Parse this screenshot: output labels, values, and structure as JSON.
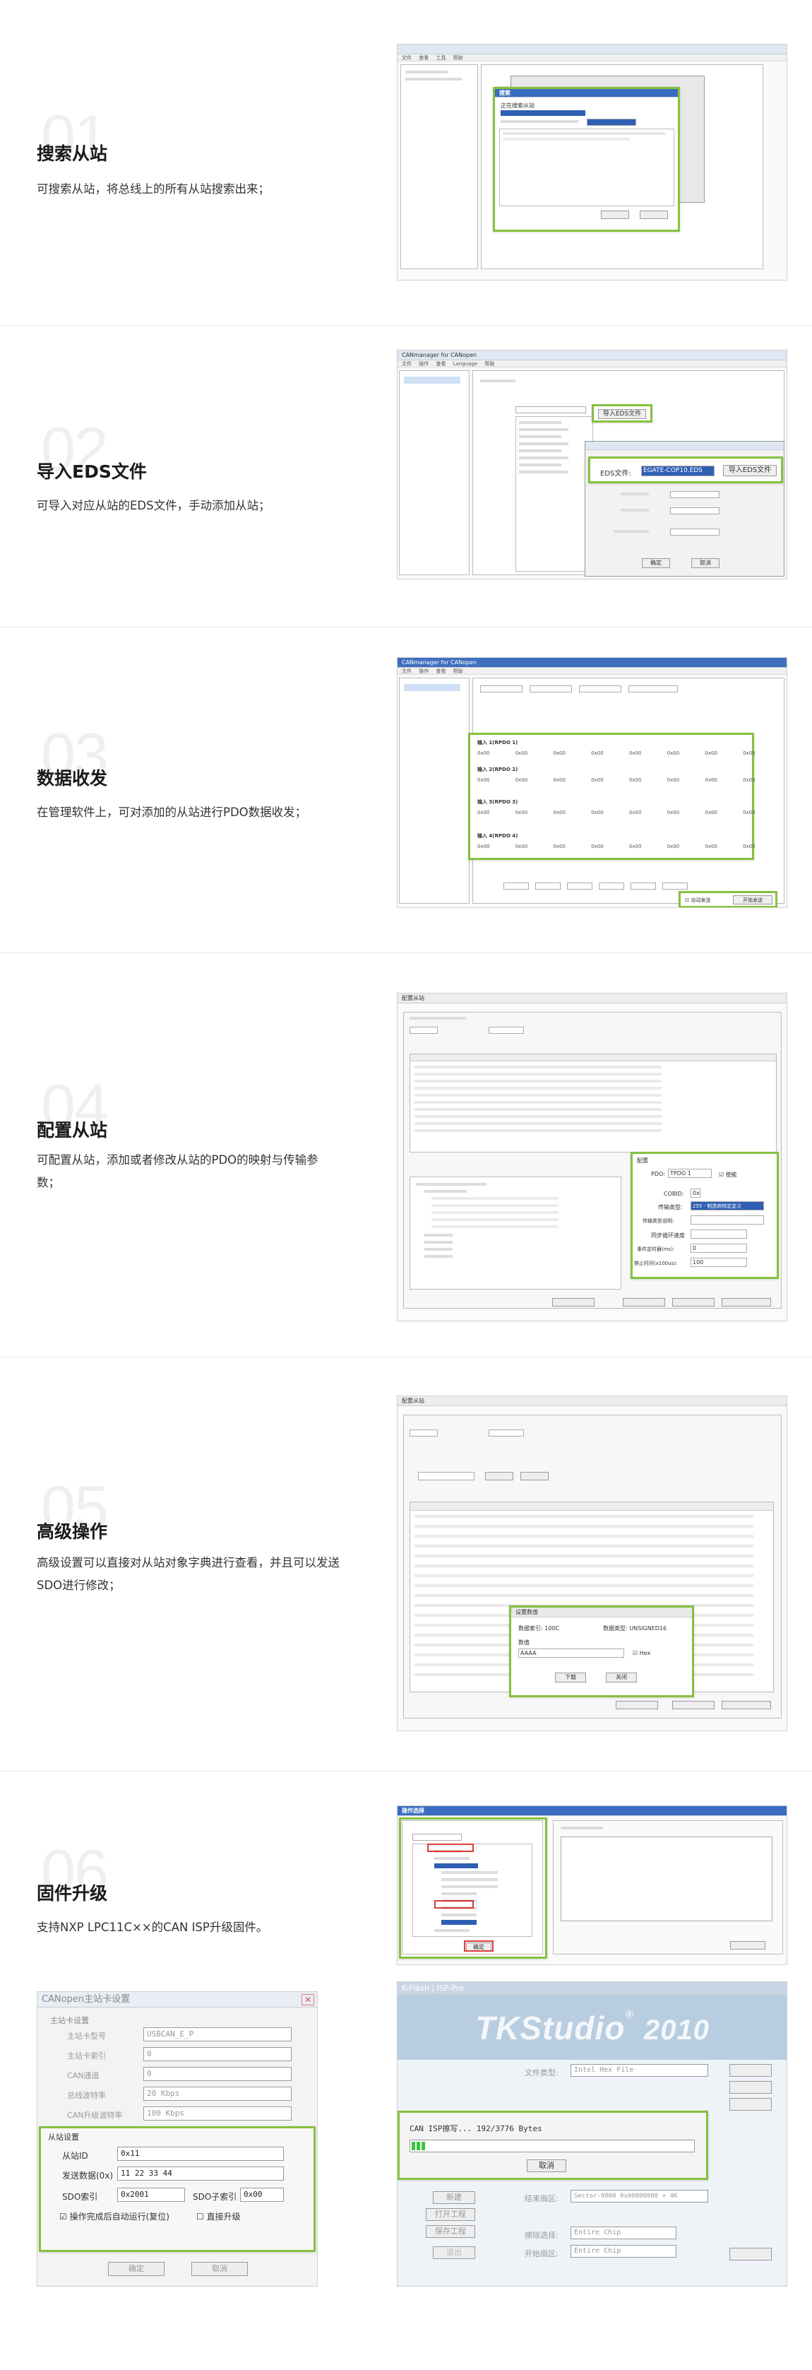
{
  "features": [
    {
      "num": "01",
      "title": "搜索从站",
      "desc": "可搜索从站，将总线上的所有从站搜索出来；"
    },
    {
      "num": "02",
      "title": "导入EDS文件",
      "desc": "可导入对应从站的EDS文件，手动添加从站；"
    },
    {
      "num": "03",
      "title": "数据收发",
      "desc": "在管理软件上，可对添加的从站进行PDO数据收发；"
    },
    {
      "num": "04",
      "title": "配置从站",
      "desc": "可配置从站，添加或者修改从站的PDO的映射与传输参数；"
    },
    {
      "num": "05",
      "title": "高级操作",
      "desc": "高级设置可以直接对从站对象字典进行查看，并且可以发送SDO进行修改；"
    },
    {
      "num": "06",
      "title": "固件升级",
      "desc": "支持NXP LPC11C××的CAN ISP升级固件。"
    }
  ],
  "shot2": {
    "app_title": "CANmanager for CANopen",
    "import_button": "导入EDS文件",
    "dialog": {
      "eds_label": "EDS文件:",
      "eds_value": "EGATE-COP10.EDS",
      "import_button": "导入EDS文件",
      "ok": "确定",
      "cancel": "取消"
    }
  },
  "shot3": {
    "app_title": "CANmanager for CANopen",
    "rows": [
      {
        "label": "输入 1(RPDO 1)",
        "cells": "0x00 0x00 0x00 0x00 0x00 0x00 0x00 0x00"
      },
      {
        "label": "输入 2(RPDO 2)",
        "cells": "0x00 0x00 0x00 0x00 0x00 0x00 0x00 0x00"
      },
      {
        "label": "输入 3(RPDO 3)",
        "cells": "0x00 0x00 0x00 0x00 0x00 0x00 0x00 0x00"
      },
      {
        "label": "输入 4(RPDO 4)",
        "cells": "0x00 0x00 0x00 0x00 0x00 0x00 0x00 0x00"
      }
    ],
    "auto_send": "自动发送",
    "send_btn": "开始发送"
  },
  "shot4": {
    "app_title": "配置从站",
    "config": {
      "group": "配置",
      "pdo_label": "PDO:",
      "pdo_value": "TPDO 1",
      "enable": "使能",
      "cobid_label": "COBID:",
      "cobid_value": "0x",
      "trans_label": "传输类型:",
      "trans_value": "255 - 制造商特定定义",
      "inhibit_label": "同步循环速度",
      "timer_label": "事件定时器(ms):",
      "timer_value": "0",
      "sync_label": "禁止时间(x100us):",
      "sync_value": "100"
    }
  },
  "shot5": {
    "app_title": "配置从站",
    "dialog": {
      "title": "设置数值",
      "index": "数据索引: 100C",
      "type": "数据类型: UNSIGNED16",
      "value_label": "数值",
      "value": "AAAA",
      "hex": "Hex",
      "send": "下载",
      "close": "关闭"
    }
  },
  "shot6a": {
    "title": "操作选择",
    "ok": "确定"
  },
  "shot6b": {
    "title": "CANopen主站卡设置",
    "master_group": "主站卡设置",
    "master_fields": [
      {
        "label": "主站卡型号",
        "value": "USBCAN_E_P"
      },
      {
        "label": "主站卡索引",
        "value": "0"
      },
      {
        "label": "CAN通道",
        "value": "0"
      },
      {
        "label": "总线波特率",
        "value": "20 Kbps"
      },
      {
        "label": "CAN升级波特率",
        "value": "100 Kbps"
      }
    ],
    "slave_group": "从站设置",
    "slave_id_label": "从站ID",
    "slave_id_value": "0x11",
    "send_data_label": "发送数据(0x)",
    "send_data_value": "11 22 33 44",
    "sdo_label": "SDO索引",
    "sdo_value": "0x2001",
    "sdo_sub_label": "SDO子索引",
    "sdo_sub_value": "0x00",
    "auto_run": "操作完成后自动运行(复位)",
    "direct": "直接升级",
    "ok": "确定",
    "cancel": "取消"
  },
  "shot6c": {
    "title": "K-Flash | ISP-Pro",
    "brand": "TKStudio",
    "brand_year": "2010",
    "file_label": "文件类型:",
    "file_value": "Intel Hex File",
    "progress_text": "CAN ISP擦写... 192/3776 Bytes",
    "progress": 0.05,
    "cancel": "取消",
    "buttons": [
      "新建",
      "打开工程",
      "保存工程",
      "退出"
    ],
    "sector_label": "结束扇区:",
    "sector_value": "Sector-0000 0x00000000 + 4K",
    "erase_label": "擦除选择:",
    "erase_value": "Entire Chip",
    "area_label": "开始扇区:",
    "area_value": "Entire Chip"
  }
}
